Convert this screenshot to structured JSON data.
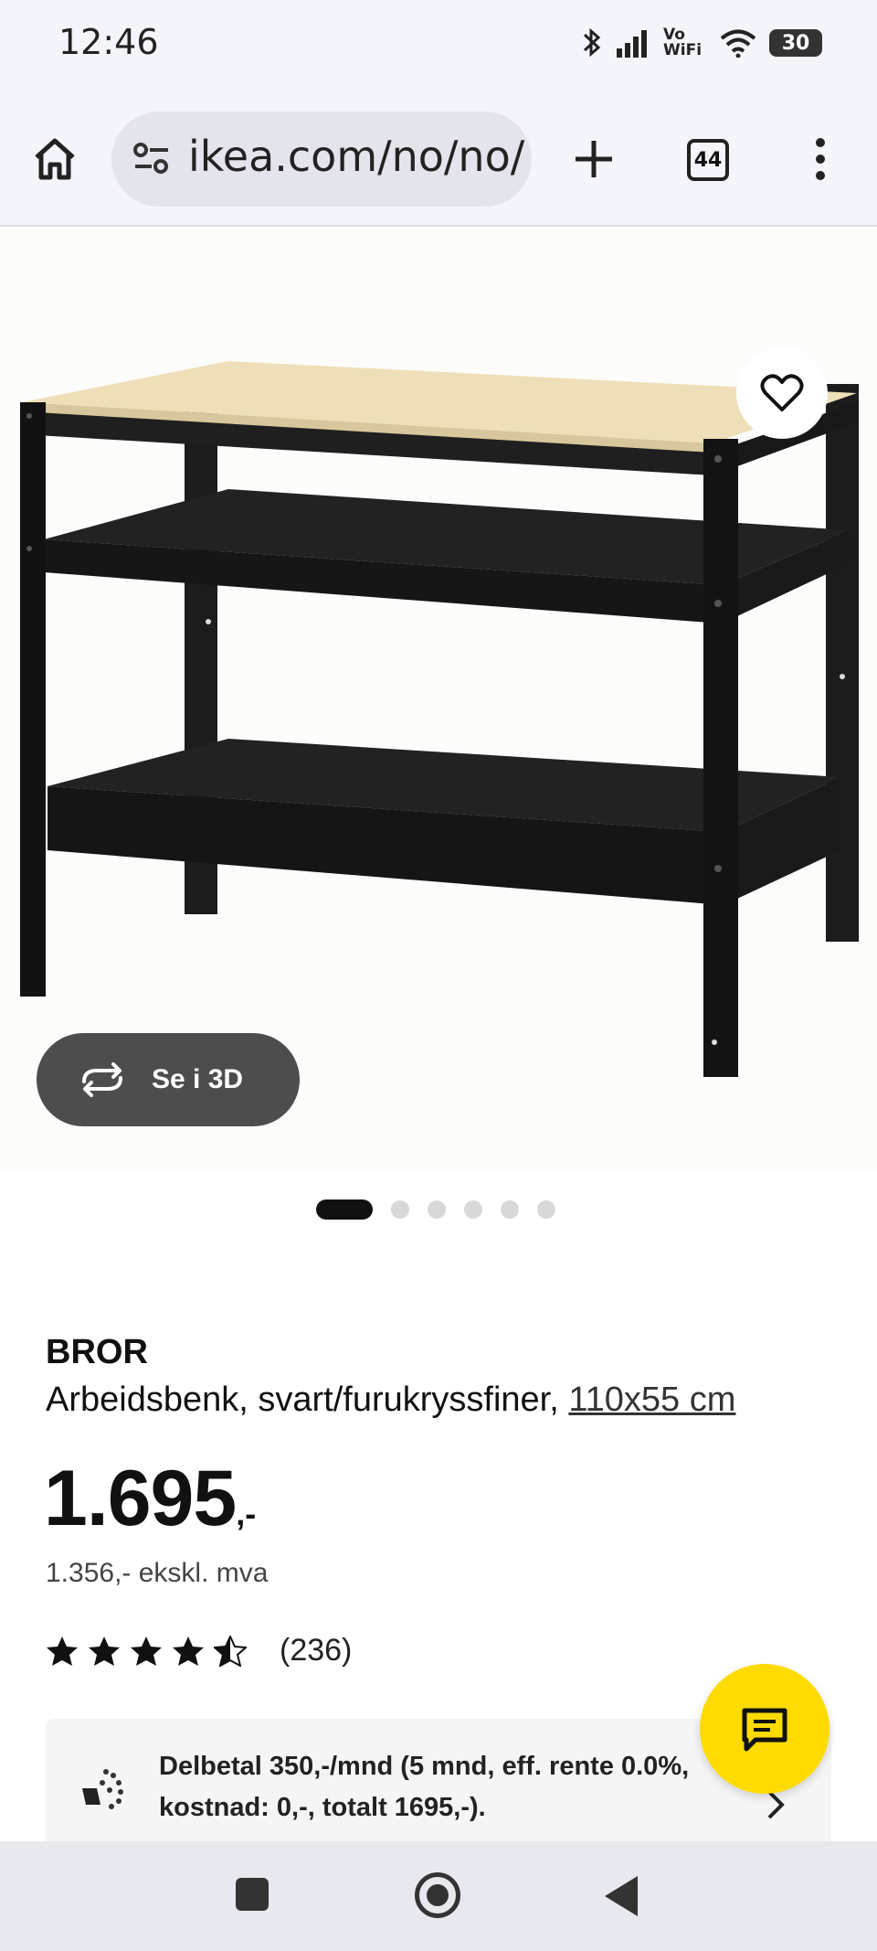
{
  "status_bar": {
    "time": "12:46",
    "volte_label": "Vo WiFi",
    "battery": "30"
  },
  "browser": {
    "url": "ikea.com/no/no/p",
    "tab_count": "44"
  },
  "gallery": {
    "view3d_label": "Se i 3D",
    "image_count": 6,
    "active_index": 0
  },
  "product": {
    "name": "BROR",
    "description": "Arbeidsbenk, svart/furukryssfiner,",
    "size": "110x55 cm",
    "price_main": "1.695",
    "price_suffix": ",-",
    "price_ex_vat": "1.356,- ekskl. mva",
    "rating_value": 4.5,
    "rating_count": "(236)"
  },
  "payment": {
    "text": "Delbetal 350,-/mnd (5 mnd, eff. rente 0.0%, kostnad: 0,-, totalt 1695,-)."
  },
  "colors": {
    "chat_button": "#ffdb00",
    "view3d_button": "#4d4d4d"
  }
}
